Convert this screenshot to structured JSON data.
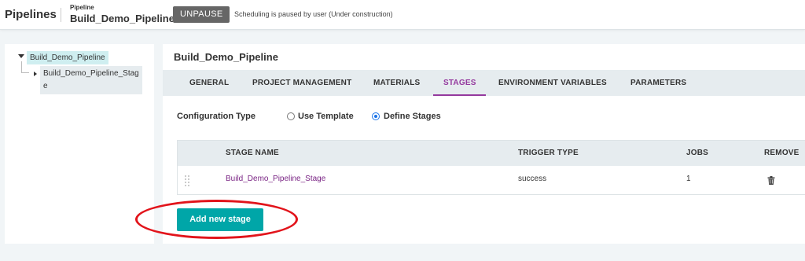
{
  "header": {
    "app_title": "Pipelines",
    "breadcrumb_label": "Pipeline",
    "pipeline_name": "Build_Demo_Pipeline",
    "unpause_label": "UNPAUSE",
    "status_message": "Scheduling is paused by user (Under construction)"
  },
  "tree": {
    "root": "Build_Demo_Pipeline",
    "child": "Build_Demo_Pipeline_Stage"
  },
  "main": {
    "title": "Build_Demo_Pipeline",
    "tabs": [
      {
        "label": "GENERAL"
      },
      {
        "label": "PROJECT MANAGEMENT"
      },
      {
        "label": "MATERIALS"
      },
      {
        "label": "STAGES"
      },
      {
        "label": "ENVIRONMENT VARIABLES"
      },
      {
        "label": "PARAMETERS"
      }
    ],
    "active_tab": "STAGES",
    "config_type": {
      "label": "Configuration Type",
      "options": [
        {
          "label": "Use Template",
          "selected": false
        },
        {
          "label": "Define Stages",
          "selected": true
        }
      ]
    },
    "table": {
      "headers": [
        "STAGE NAME",
        "TRIGGER TYPE",
        "JOBS",
        "REMOVE"
      ],
      "rows": [
        {
          "stage_name": "Build_Demo_Pipeline_Stage",
          "trigger_type": "success",
          "jobs": "1"
        }
      ]
    },
    "add_button_label": "Add new stage"
  },
  "colors": {
    "accent_purple": "#94399e",
    "link_purple": "#7a2484",
    "button_teal": "#00a6a8",
    "annotation_red": "#e2141b"
  },
  "icons": [
    "drag-handle-icon",
    "trash-icon",
    "caret-down-icon",
    "caret-right-icon"
  ]
}
